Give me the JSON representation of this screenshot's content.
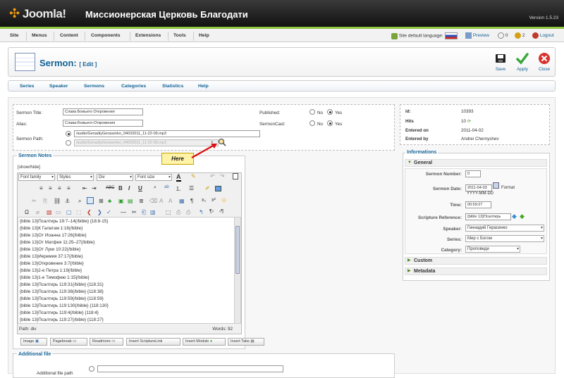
{
  "header": {
    "logo": "Joomla!",
    "site_title": "Миссионерская Церковь Благодати",
    "version": "Version 1.5.23"
  },
  "menubar": {
    "items": [
      "Site",
      "Menus",
      "Content",
      "Components",
      "Extensions",
      "Tools",
      "Help"
    ],
    "language_label": "Site default language:",
    "preview": "Preview",
    "messages": "0",
    "users": "2",
    "logout": "Logout"
  },
  "toolbar": {
    "title": "Sermon:",
    "edit": "[ Edit ]",
    "save": "Save",
    "apply": "Apply",
    "close": "Close"
  },
  "submenu": [
    "Series",
    "Speaker",
    "Sermons",
    "Categories",
    "Statistics",
    "Help"
  ],
  "form": {
    "title_label": "Sermon Title:",
    "title_value": "Слава Божьего Откровения",
    "alias_label": "Alias:",
    "alias_value": "Слава-Божьего-Откровения",
    "path_label": "Sermon Path:",
    "path_value": "/audio/GenadiyGerasenko_04032011_11-22-09.mp3",
    "path_value2": "/audio/GenadiyGerasenko_04032011_11-22-09.mp3",
    "published_label": "Published:",
    "sermoncast_label": "SermonCast:",
    "no": "No",
    "yes": "Yes"
  },
  "info": {
    "id_label": "id:",
    "id_value": "10393",
    "hits_label": "Hits",
    "hits_value": "10",
    "entered_on_label": "Entered on",
    "entered_on_value": "2011-04-02",
    "entered_by_label": "Entered by",
    "entered_by_value": "Andrei Chernyshev"
  },
  "notes": {
    "legend": "Sermon Notes",
    "toggle": "[show/hide]",
    "font_family": "Font family",
    "styles": "Styles",
    "div": "Div",
    "font_size": "Font size",
    "lines": [
      "{bible 13}Псалтирь 19:7–14{/bible} {18:8-15}",
      "{bible 13}К Галатам 1:16{/bible}",
      "{bible 13}От Иоанна 17:26{/bible}",
      "{bible 13}От Матфея 11:25–27{/bible}",
      "{bible 13}От Луки 10:22{/bible}",
      "{bible 13}Иеремия 37:17{/bible}",
      "{bible 13}Откровение 3:7{/bible}",
      "{bible 13}2-е Петра 1:19{/bible}",
      "{bible 13}1-е Тимофею 1:15{/bible}",
      "{bible 13}Псалтирь 119:31{/bible} {118:31}",
      "{bible 13}Псалтирь 119:38{/bible} {118:38}",
      "{bible 13}Псалтирь 119:59{/bible} {118:59}",
      "{bible 13}Псалтирь 119:130{/bible} {118:130}",
      "{bible 13}Псалтирь 119:4{/bible} {118:4}",
      "{bible 13}Псалтирь 119:27{/bible} {118:27}"
    ],
    "path": "Path: div",
    "words": "Words: 92",
    "buttons": [
      "Image",
      "Pagebreak",
      "Readmore",
      "Insert ScriptureLink",
      "Insert Module",
      "Insert Tabs"
    ]
  },
  "callout": "Here",
  "additional": {
    "legend": "Additional file",
    "label": "Additional file path"
  },
  "informations": {
    "legend": "Informations",
    "general": "General",
    "number_label": "Sermon Number:",
    "number_value": "0",
    "date_label": "Sermon Date:",
    "date_value": "2011-04-03",
    "format_label": "Format",
    "format_value": "YYYY-MM-DD",
    "time_label": "Time:",
    "time_value": "00:59:27",
    "scripture_label": "Scripture Reference:",
    "scripture_value": "{bible 13}Псалтирь",
    "speaker_label": "Speaker:",
    "speaker_value": "Геннадий Герасенко",
    "series_label": "Series:",
    "series_value": "Мир с Богом",
    "category_label": "Category:",
    "category_value": "Проповеди",
    "custom": "Custom",
    "metadata": "Metadata"
  },
  "colors": {
    "accent": "#146295",
    "menubar_stripe": "#8ec63f"
  }
}
